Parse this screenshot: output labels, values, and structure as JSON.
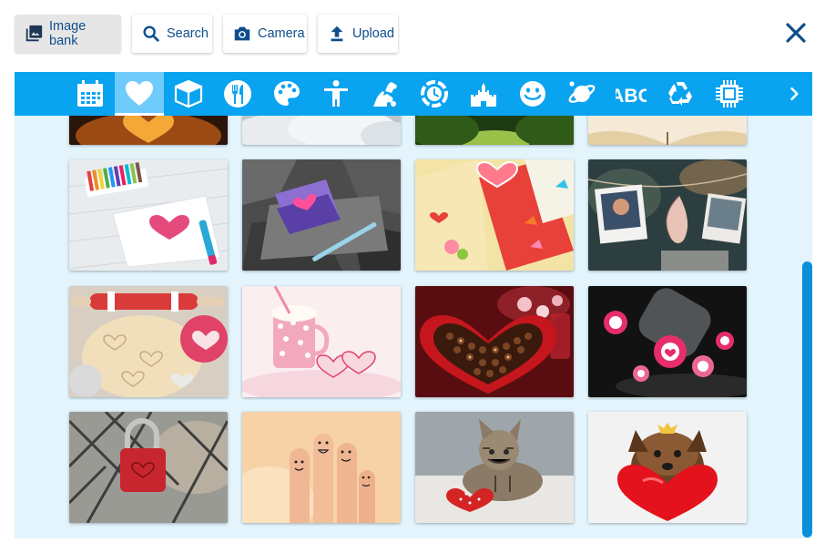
{
  "toolbar": {
    "image_bank_label": "Image bank",
    "search_label": "Search",
    "camera_label": "Camera",
    "upload_label": "Upload"
  },
  "categories": [
    {
      "name": "calendar",
      "icon": "calendar-icon"
    },
    {
      "name": "love",
      "icon": "heart-icon",
      "active": true
    },
    {
      "name": "objects",
      "icon": "box-icon"
    },
    {
      "name": "food",
      "icon": "cutlery-icon"
    },
    {
      "name": "art",
      "icon": "palette-icon"
    },
    {
      "name": "people",
      "icon": "person-icon"
    },
    {
      "name": "animals",
      "icon": "animals-icon"
    },
    {
      "name": "time",
      "icon": "globe-clock-icon"
    },
    {
      "name": "places",
      "icon": "castle-icon"
    },
    {
      "name": "emotions",
      "icon": "smiley-icon"
    },
    {
      "name": "space",
      "icon": "planet-icon"
    },
    {
      "name": "letters",
      "icon": "abc-icon",
      "text": "ABC"
    },
    {
      "name": "recycling",
      "icon": "recycle-icon"
    },
    {
      "name": "technology",
      "icon": "chip-icon"
    }
  ],
  "gallery": {
    "rows": [
      [
        "pumpkin-heart",
        "clouds",
        "forest",
        "open-book"
      ],
      [
        "crayon-heart-drawing",
        "heart-diary-on-rock",
        "valentine-cards",
        "photos-on-line"
      ],
      [
        "cookie-dough-hearts",
        "cocoa-mug-cookies",
        "heart-chocolate-box",
        "heart-candies-jar"
      ],
      [
        "padlock-on-fence",
        "finger-faces",
        "kitten-with-heart-pillow",
        "dog-with-heart-pillow"
      ]
    ]
  },
  "colors": {
    "accent": "#0aa3f0",
    "accent_light": "#6ecbfb",
    "text_dark_blue": "#0f4e8c",
    "gallery_bg": "#e3f4fd",
    "scrollbar": "#0a8fdb"
  }
}
